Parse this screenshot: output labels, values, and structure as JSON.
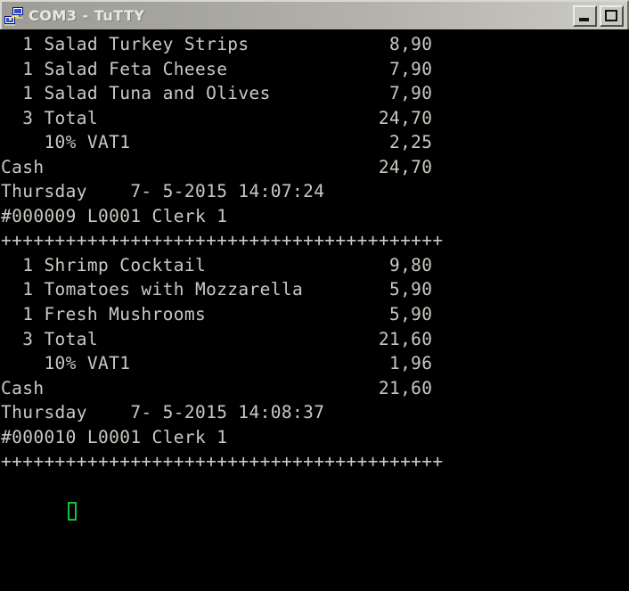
{
  "window": {
    "title": "COM3 - TuTTY",
    "icon": "network-computers-icon",
    "buttons": {
      "minimize_label": "Minimize",
      "maximize_label": "Maximize"
    },
    "colors": {
      "titlebar_gradient_start": "#9d9d96",
      "titlebar_gradient_end": "#cfcfc7",
      "title_text": "#e9e9e4",
      "terminal_background": "#000000",
      "terminal_foreground": "#c9c9c4",
      "cursor": "#16c232"
    }
  },
  "terminal": {
    "lines": [
      "  1 Salad Turkey Strips             8,90",
      "  1 Salad Feta Cheese               7,90",
      "  1 Salad Tuna and Olives           7,90",
      "  3 Total                          24,70",
      "    10% VAT1                        2,25",
      "Cash                               24,70",
      "Thursday    7- 5-2015 14:07:24",
      "#000009 L0001 Clerk 1",
      "+++++++++++++++++++++++++++++++++++++++++",
      "  1 Shrimp Cocktail                 9,80",
      "  1 Tomatoes with Mozzarella        5,90",
      "  1 Fresh Mushrooms                 5,90",
      "  3 Total                          21,60",
      "    10% VAT1                        1,96",
      "Cash                               21,60",
      "Thursday    7- 5-2015 14:08:37",
      "#000010 L0001 Clerk 1",
      "+++++++++++++++++++++++++++++++++++++++++"
    ],
    "receipts": [
      {
        "items": [
          {
            "qty": "1",
            "name": "Salad Turkey Strips",
            "amount": "8,90"
          },
          {
            "qty": "1",
            "name": "Salad Feta Cheese",
            "amount": "7,90"
          },
          {
            "qty": "1",
            "name": "Salad Tuna and Olives",
            "amount": "7,90"
          }
        ],
        "total_qty": "3",
        "total_label": "Total",
        "total_amount": "24,70",
        "vat_label": "10% VAT1",
        "vat_amount": "2,25",
        "payment_label": "Cash",
        "payment_amount": "24,70",
        "weekday": "Thursday",
        "date": "7- 5-2015",
        "time": "14:07:24",
        "receipt_no": "#000009",
        "register": "L0001",
        "clerk": "Clerk 1",
        "separator": "+++++++++++++++++++++++++++++++++++++++++"
      },
      {
        "items": [
          {
            "qty": "1",
            "name": "Shrimp Cocktail",
            "amount": "9,80"
          },
          {
            "qty": "1",
            "name": "Tomatoes with Mozzarella",
            "amount": "5,90"
          },
          {
            "qty": "1",
            "name": "Fresh Mushrooms",
            "amount": "5,90"
          }
        ],
        "total_qty": "3",
        "total_label": "Total",
        "total_amount": "21,60",
        "vat_label": "10% VAT1",
        "vat_amount": "1,96",
        "payment_label": "Cash",
        "payment_amount": "21,60",
        "weekday": "Thursday",
        "date": "7- 5-2015",
        "time": "14:08:37",
        "receipt_no": "#000010",
        "register": "L0001",
        "clerk": "Clerk 1",
        "separator": "+++++++++++++++++++++++++++++++++++++++++"
      }
    ],
    "cursor_visible": true
  }
}
